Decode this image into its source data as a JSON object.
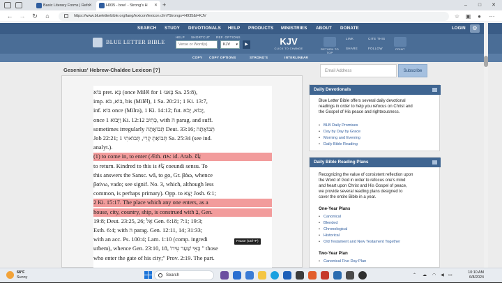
{
  "browser": {
    "tabs": [
      {
        "title": "Basic Literary Forms | Refo"
      },
      {
        "title": "H935 - bow' - Strong's H"
      }
    ],
    "new_tab": "+",
    "url": "https://www.blueletterbible.org/lang/lexicon/lexicon.cfm?Strongs=H935&t=KJV",
    "window_controls": [
      "–",
      "□",
      "✕"
    ]
  },
  "blb": {
    "nav": [
      "SEARCH",
      "STUDY",
      "DEVOTIONALS",
      "HELP",
      "PRODUCTS",
      "MINISTRIES",
      "ABOUT",
      "DONATE"
    ],
    "login": "LOGIN",
    "logo_text": "BLUE LETTER BIBLE",
    "labels": {
      "help": "HELP",
      "shortcut": "SHORTCUT",
      "options": "REF. OPTIONS"
    },
    "search_placeholder": "Verse or Word(s)",
    "version": "KJV",
    "go": "▶",
    "kjv_big": "KJV",
    "kjv_sub": "CLICK TO CHANGE",
    "return_to_top": "RETURN TO TOP",
    "link": "LINK",
    "cite_this": "CITE THIS",
    "share": "SHARE",
    "follow": "FOLLOW",
    "print": "PRINT",
    "toolbar": [
      "COPY",
      "COPY OPTIONS",
      "STRONG'S",
      "INTERLINEAR"
    ]
  },
  "lexicon": {
    "title": "Gesenius' Hebrew-Chaldee Lexicon [?]",
    "lines": [
      {
        "text": "בּוֹא pret. בָּא (once Milêl for בָּאנוּ 1 Sa. 25:8),",
        "hl": false
      },
      {
        "text": "imp. בּוֹא, בֹּא, bis (Milêl), 1 Sa. 20:21; 1 Ki. 13:7,",
        "hl": false
      },
      {
        "text": "inf. בּוֹא once (Milra), 1 Ki. 14:12; fut. יָבוֹא, יָבֹא,",
        "hl": false
      },
      {
        "text": "once וַיָּבֹוא 1 Ki. 12:12 כְּתִיב, with ה parag. and suff.",
        "hl": false
      },
      {
        "text": "sometimes irregularly תְּבוֹאָתָה Deut. 33:16; תְּבוֹאָתָה",
        "hl": false
      },
      {
        "text": "Job 22:21; תְּבוֹאַתְ קְרִי, תְּבוֹאתִי 1 Sa. 25:34 (see ind.",
        "hl": false
      },
      {
        "text": "analyt.).",
        "hl": false
      },
      {
        "text": "(1) to come in, to enter (Æth. በአ: id. Arab. بَاءَ",
        "hl": true
      },
      {
        "text": "to return. Kindred to this is بَاءَ coeundi sensu. To",
        "hl": false
      },
      {
        "text": "this answers the Sansc. wâ, to go, Gr. βάω, whence",
        "hl": false
      },
      {
        "text": "βαίνω, vado; see signif. No. 3, which, although less",
        "hl": false
      },
      {
        "text": "common, is perhaps primary). Opp. to יָצָא Josh. 6:1;",
        "hl": false
      },
      {
        "text": "2 Ki. 15:17. The place which any one enters, as a",
        "hl": true
      },
      {
        "text": "house, city, country, ship, is construed with בְּ, Gen.",
        "hl": true
      },
      {
        "text": "19:8; Deut. 23:25, 26; אֶל Gen. 6:18; 7:1; 19:3;",
        "hl": false
      },
      {
        "text": "Esth. 6:4; with ה parag. Gen. 12:11, 14; 31:33;",
        "hl": false
      },
      {
        "text": "with an acc. Ps. 100:4; Lam. 1:10 (comp. ingredi",
        "hl": false
      },
      {
        "text": "urbem), whence Gen. 23:10, 18, בָּאֵי שַׁעַר עִירוֹ \" those",
        "hl": false
      },
      {
        "text": "who enter the gate of his city;\" Prov. 2:19. The part.",
        "hl": false
      }
    ],
    "tooltip": "Pause (Ctrl+P)"
  },
  "sidebar": {
    "email_placeholder": "Email Address",
    "subscribe": "Subscribe",
    "devotionals": {
      "title": "Daily Devotionals",
      "body": [
        "Blue Letter Bible offers several daily devotional",
        "readings in order to help you refocus on Christ and",
        "the Gospel of His peace and righteousness."
      ],
      "items": [
        "BLB Daily Promises",
        "Day by Day by Grace",
        "Morning and Evening",
        "Daily Bible Reading"
      ]
    },
    "plans": {
      "title": "Daily Bible Reading Plans",
      "body": [
        "Recognizing the value of consistent reflection upon",
        "the Word of God in order to refocus one's mind",
        "and heart upon Christ and His Gospel of peace,",
        "we provide several reading plans designed to",
        "cover the entire Bible in a year."
      ],
      "one_year": "One-Year Plans",
      "one_year_items": [
        "Canonical",
        "Blended",
        "Chronological",
        "Historical",
        "Old Testament and New Testament Together"
      ],
      "two_year": "Two-Year Plan",
      "two_year_items": [
        "Canonical Five Day Plan"
      ]
    }
  },
  "taskbar": {
    "temp": "68°F",
    "weather": "Sunny",
    "search": "Search",
    "time": "10:10 AM",
    "date": "6/8/2024"
  }
}
